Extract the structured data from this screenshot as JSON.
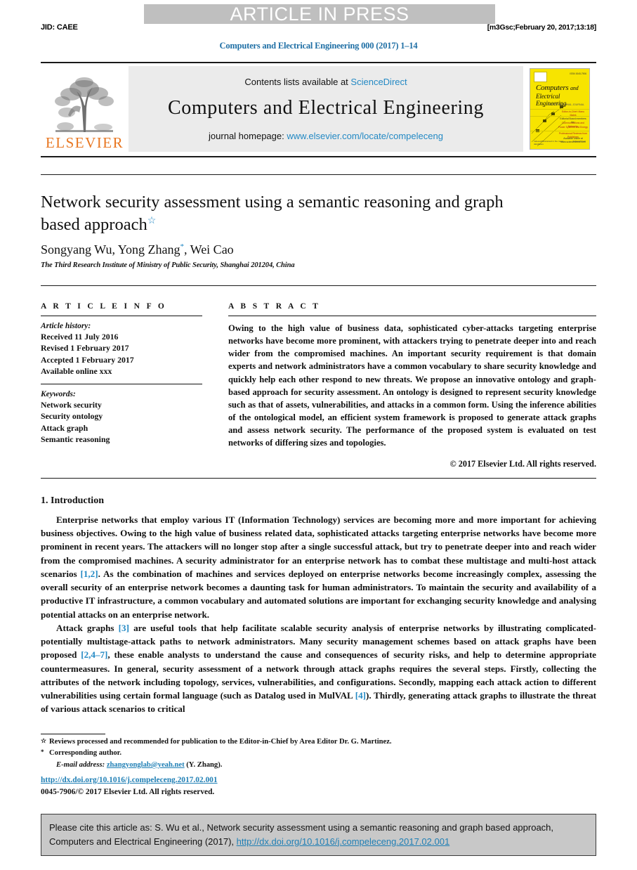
{
  "banner": {
    "press_label": "ARTICLE IN PRESS",
    "jid": "JID: CAEE",
    "stamp": "[m3Gsc;February 20, 2017;13:18]",
    "journal_ref": "Computers and Electrical Engineering 000 (2017) 1–14"
  },
  "masthead": {
    "contents_prefix": "Contents lists available at",
    "contents_link": "ScienceDirect",
    "journal_title": "Computers and Electrical Engineering",
    "homepage_prefix": "journal homepage:",
    "homepage_link": "www.elsevier.com/locate/compeleceng",
    "publisher_wordmark": "ELSEVIER",
    "cover": {
      "title_line1": "Computers",
      "title_and": "and",
      "title_line2": "Electrical Engineering",
      "brand_small": "ISSN 0045-7906",
      "subtitle": "AN INTERNATIONAL JOURNAL",
      "feature1": "Editor-in-Chief: Manu Malek",
      "feature2": "Editorial Board members for:",
      "feature3": "Communications and Networks",
      "feature4": "Power Systems and Energy",
      "feature5": "Professional Reviews from Publishers",
      "feature6": "Available online at www.sciencedirect.com",
      "footer_left": "Indexed/Abstracted in the major databases",
      "footer_right": "ScienceDirect"
    }
  },
  "article": {
    "title": "Network security assessment using a semantic reasoning and graph based approach",
    "title_star": "☆",
    "authors_pre": "Songyang Wu, Yong Zhang",
    "author_star": "*",
    "authors_post": ", Wei Cao",
    "affiliation": "The Third Research Institute of Ministry of Public Security, Shanghai 201204, China"
  },
  "info": {
    "heading": "A R T I C L E   I N F O",
    "history_label": "Article history:",
    "history": [
      "Received 11 July 2016",
      "Revised 1 February 2017",
      "Accepted 1 February 2017",
      "Available online xxx"
    ],
    "keywords_label": "Keywords:",
    "keywords": [
      "Network security",
      "Security ontology",
      "Attack graph",
      "Semantic reasoning"
    ]
  },
  "abstract": {
    "heading": "A B S T R A C T",
    "text": "Owing to the high value of business data, sophisticated cyber-attacks targeting enterprise networks have become more prominent, with attackers trying to penetrate deeper into and reach wider from the compromised machines. An important security requirement is that domain experts and network administrators have a common vocabulary to share security knowledge and quickly help each other respond to new threats. We propose an innovative ontology and graph-based approach for security assessment. An ontology is designed to represent security knowledge such as that of assets, vulnerabilities, and attacks in a common form. Using the inference abilities of the ontological model, an efficient system framework is proposed to generate attack graphs and assess network security. The performance of the proposed system is evaluated on test networks of differing sizes and topologies.",
    "copyright": "© 2017 Elsevier Ltd. All rights reserved."
  },
  "body": {
    "section_heading": "1. Introduction",
    "paragraph1_a": "Enterprise networks that employ various IT (Information Technology) services are becoming more and more important for achieving business objectives. Owing to the high value of business related data, sophisticated attacks targeting enterprise networks have become more prominent in recent years. The attackers will no longer stop after a single successful attack, but try to penetrate deeper into and reach wider from the compromised machines. A security administrator for an enterprise network has to combat these multistage and multi-host attack scenarios ",
    "paragraph1_cite1": "[1,2]",
    "paragraph1_b": ". As the combination of machines and services deployed on enterprise networks become increasingly complex, assessing the overall security of an enterprise network becomes a daunting task for human administrators. To maintain the security and availability of a productive IT infrastructure, a common vocabulary and automated solutions are important for exchanging security knowledge and analysing potential attacks on an enterprise network.",
    "paragraph2_a": "Attack graphs ",
    "paragraph2_cite1": "[3]",
    "paragraph2_b": " are useful tools that help facilitate scalable security analysis of enterprise networks by illustrating complicated-potentially multistage-attack paths to network administrators. Many security management schemes based on attack graphs have been proposed ",
    "paragraph2_cite2": "[2,4–7]",
    "paragraph2_c": ", these enable analysts to understand the cause and consequences of security risks, and help to determine appropriate countermeasures. In general, security assessment of a network through attack graphs requires the several steps. Firstly, collecting the attributes of the network including topology, services, vulnerabilities, and configurations. Secondly, mapping each attack action to different vulnerabilities using certain formal language (such as Datalog used in MulVAL ",
    "paragraph2_cite3": "[4]",
    "paragraph2_d": "). Thirdly, generating attack graphs to illustrate the threat of various attack scenarios to critical"
  },
  "footnotes": {
    "star_mark": "☆",
    "star_text": "Reviews processed and recommended for publication to the Editor-in-Chief by Area Editor Dr. G. Martinez.",
    "corr_mark": "*",
    "corr_text": "Corresponding author.",
    "email_label": "E-mail address:",
    "email": "zhangyonglab@yeah.net",
    "email_suffix": "(Y. Zhang).",
    "doi": "http://dx.doi.org/10.1016/j.compeleceng.2017.02.001",
    "issn_line": "0045-7906/© 2017 Elsevier Ltd. All rights reserved."
  },
  "cite_box": {
    "text_a": "Please cite this article as: S. Wu et al., Network security assessment using a semantic reasoning and graph based approach, Computers and Electrical Engineering (2017), ",
    "doi_link": "http://dx.doi.org/10.1016/j.compeleceng.2017.02.001"
  },
  "colors": {
    "link_blue": "#2389c4",
    "elsevier_orange": "#e87722",
    "banner_gray": "#bfbfbf",
    "cite_box_gray": "#c8c8c8",
    "cover_yellow": "#f7e400"
  }
}
